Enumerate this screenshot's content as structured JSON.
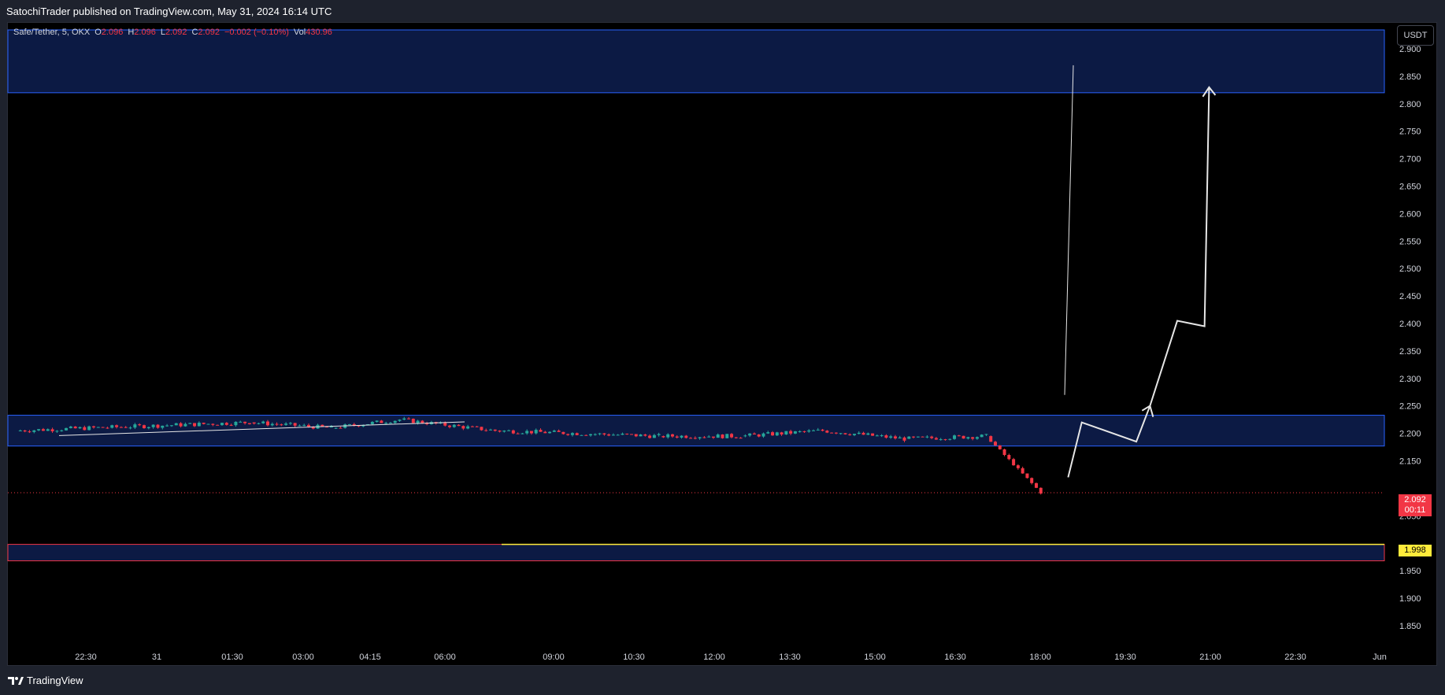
{
  "header": {
    "published_text": "SatochiTrader published on TradingView.com, May 31, 2024 16:14 UTC"
  },
  "legend": {
    "symbol": "Safe/Tether, 5, OKX",
    "open_label": "O",
    "open": "2.096",
    "high_label": "H",
    "high": "2.096",
    "low_label": "L",
    "low": "2.092",
    "close_label": "C",
    "close": "2.092",
    "change": "−0.002 (−0.10%)",
    "vol_label": "Vol",
    "vol": "430.96"
  },
  "price_axis": {
    "unit": "USDT",
    "labels": [
      "2.900",
      "2.850",
      "2.800",
      "2.750",
      "2.700",
      "2.650",
      "2.600",
      "2.550",
      "2.500",
      "2.450",
      "2.400",
      "2.350",
      "2.300",
      "2.250",
      "2.200",
      "2.150",
      "2.050",
      "1.950",
      "1.900",
      "1.850"
    ],
    "current_price": "2.092",
    "countdown": "00:11",
    "level_price": "1.998"
  },
  "time_axis": {
    "labels": [
      "22:30",
      "31",
      "01:30",
      "03:00",
      "04:15",
      "06:00",
      "09:00",
      "10:30",
      "12:00",
      "13:30",
      "15:00",
      "16:30",
      "18:00",
      "19:30",
      "21:00",
      "22:30",
      "Jun"
    ]
  },
  "colors": {
    "up": "#26a69a",
    "down": "#f23645",
    "zone_fill": "#0c1a44",
    "zone_border": "#2962ff",
    "support_border": "#f23645",
    "level_line": "#ffeb3b",
    "projection": "#e6e6e6"
  },
  "chart_data": {
    "type": "candlestick",
    "symbol": "Safe/Tether",
    "timeframe": "5",
    "exchange": "OKX",
    "y_axis": {
      "min": 1.85,
      "max": 2.9,
      "unit": "USDT"
    },
    "zones": [
      {
        "type": "resistance",
        "from": 2.82,
        "to": 2.95
      },
      {
        "type": "range",
        "from": 2.177,
        "to": 2.233
      },
      {
        "type": "support",
        "from": 1.968,
        "to": 1.998
      }
    ],
    "horizontal_level": 1.998,
    "current_price": 2.092,
    "price_series": [
      {
        "t": "22:30",
        "price": 2.205
      },
      {
        "t": "01:30",
        "price": 2.22
      },
      {
        "t": "03:00",
        "price": 2.21
      },
      {
        "t": "04:15",
        "price": 2.225
      },
      {
        "t": "06:00",
        "price": 2.205
      },
      {
        "t": "09:00",
        "price": 2.195
      },
      {
        "t": "10:30",
        "price": 2.195
      },
      {
        "t": "12:00",
        "price": 2.205
      },
      {
        "t": "13:30",
        "price": 2.19
      },
      {
        "t": "15:00",
        "price": 2.195
      },
      {
        "t": "16:00",
        "price": 2.092
      }
    ],
    "projection_path": [
      {
        "t": "16:30",
        "price": 2.12
      },
      {
        "t": "16:45",
        "price": 2.22
      },
      {
        "t": "17:45",
        "price": 2.185
      },
      {
        "t": "18:00",
        "price": 2.25
      },
      {
        "t": "18:30",
        "price": 2.405
      },
      {
        "t": "19:00",
        "price": 2.395
      },
      {
        "t": "19:05",
        "price": 2.83
      }
    ]
  },
  "footer": {
    "brand": "TradingView"
  }
}
